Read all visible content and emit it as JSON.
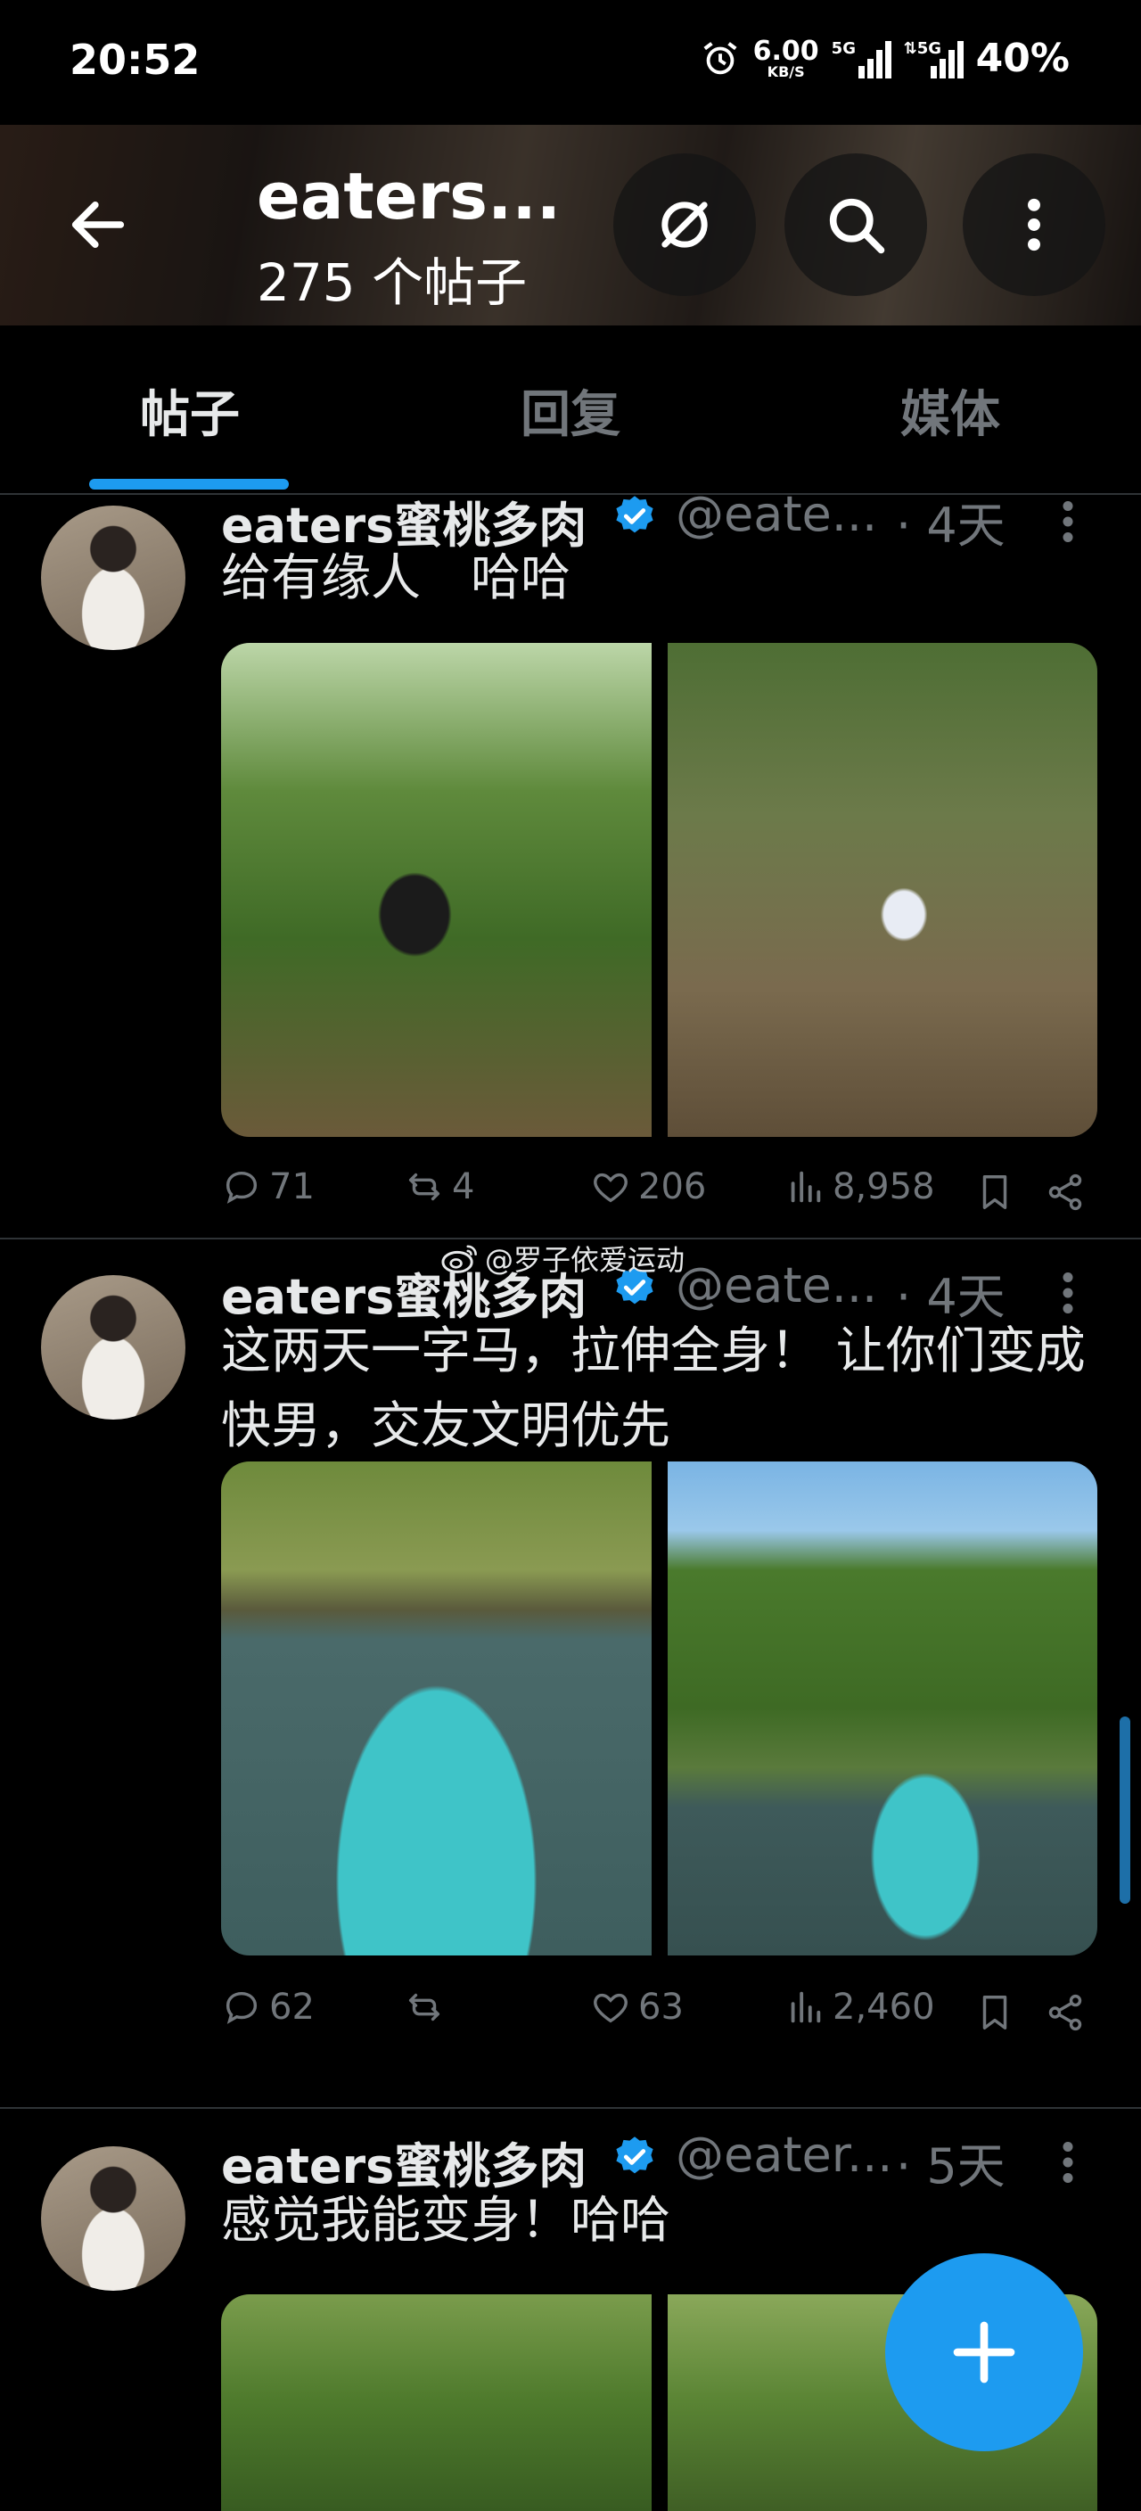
{
  "status_bar": {
    "time": "20:52",
    "speed_value": "6.00",
    "speed_unit": "KB/S",
    "sim1_tag": "5G",
    "sim2_tag": "⇅5G",
    "battery": "40%"
  },
  "header": {
    "title": "eaters...",
    "subtitle": "275 个帖子",
    "icons": [
      "back-arrow-icon",
      "circle-slash-icon",
      "search-icon",
      "more-vertical-icon"
    ]
  },
  "tabs": [
    {
      "label": "帖子",
      "active": true
    },
    {
      "label": "回复",
      "active": false
    },
    {
      "label": "媒体",
      "active": false
    }
  ],
  "watermark": "@罗子依爱运动",
  "posts": [
    {
      "name": "eaters蜜桃多肉",
      "handle": "@eate...",
      "time": "· 4天",
      "text": "给有缘人　哈哈",
      "replies": "71",
      "reposts": "4",
      "likes": "206",
      "views": "8,958"
    },
    {
      "name": "eaters蜜桃多肉",
      "handle": "@eate...",
      "time": "· 4天",
      "text": "这两天一字马，拉伸全身！ 让你们变成快男，交友文明优先",
      "replies": "62",
      "reposts": "",
      "likes": "63",
      "views": "2,460"
    },
    {
      "name": "eaters蜜桃多肉",
      "handle": "@eater...",
      "time": "· 5天",
      "text": "感觉我能变身！哈哈"
    }
  ],
  "colors": {
    "accent": "#1d9bf0",
    "background": "#000000",
    "muted": "#71767b",
    "text": "#e7e9ea"
  }
}
